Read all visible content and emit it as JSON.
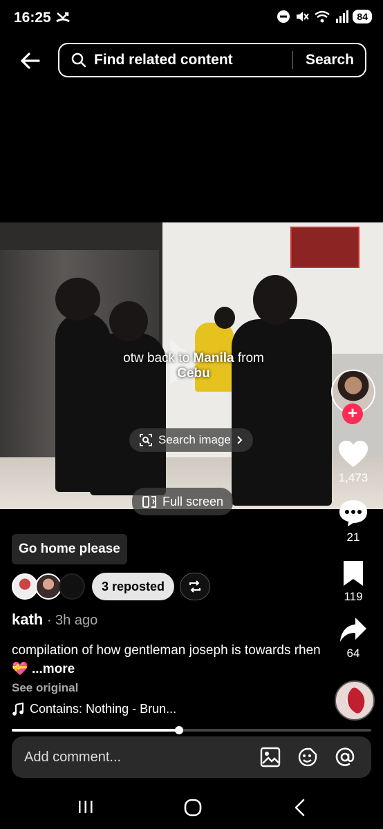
{
  "status_bar": {
    "time": "16:25",
    "battery": "84"
  },
  "search": {
    "placeholder": "Find related content",
    "button": "Search"
  },
  "video": {
    "overlay_text_1": "otw back to ",
    "overlay_text_bold": "Manila",
    "overlay_text_2": " from",
    "overlay_text_3": "Cebu",
    "search_image_label": "Search image",
    "full_screen_label": "Full screen"
  },
  "actions": {
    "likes": "1,473",
    "comments": "21",
    "saves": "119",
    "shares": "64"
  },
  "post": {
    "caption_badge": "Go home please",
    "reposted_label": "3 reposted",
    "author": "kath",
    "time": " · 3h ago",
    "description": "compilation of how gentleman joseph is towards rhen 💝 ",
    "more": "...more",
    "see_original": "See original",
    "music": "Contains: Nothing - Brun..."
  },
  "progress": {
    "fraction": 0.465
  },
  "comment": {
    "placeholder": "Add comment..."
  },
  "colors": {
    "accent": "#fe2c55",
    "background": "#000000"
  },
  "icons": [
    "back-arrow-icon",
    "search-icon",
    "heart-icon",
    "comment-icon",
    "bookmark-icon",
    "share-icon",
    "music-note-icon",
    "image-icon",
    "emoji-icon",
    "at-icon",
    "repost-icon"
  ]
}
